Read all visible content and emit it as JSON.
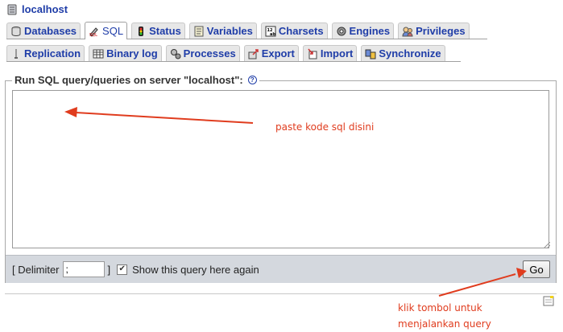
{
  "header": {
    "server_label": "localhost"
  },
  "tabs_row1": [
    {
      "label": "Databases",
      "icon": "database-icon"
    },
    {
      "label": "SQL",
      "icon": "sql-icon",
      "active": true
    },
    {
      "label": "Status",
      "icon": "status-icon"
    },
    {
      "label": "Variables",
      "icon": "variables-icon"
    },
    {
      "label": "Charsets",
      "icon": "charsets-icon"
    },
    {
      "label": "Engines",
      "icon": "engines-icon"
    },
    {
      "label": "Privileges",
      "icon": "privileges-icon"
    }
  ],
  "tabs_row2": [
    {
      "label": "Replication",
      "icon": "replication-icon"
    },
    {
      "label": "Binary log",
      "icon": "binary-log-icon"
    },
    {
      "label": "Processes",
      "icon": "processes-icon"
    },
    {
      "label": "Export",
      "icon": "export-icon"
    },
    {
      "label": "Import",
      "icon": "import-icon"
    },
    {
      "label": "Synchronize",
      "icon": "synchronize-icon"
    }
  ],
  "query_form": {
    "legend": "Run SQL query/queries on server \"localhost\":",
    "help_icon": "help-icon",
    "textarea_value": "",
    "delimiter_label_open": "[ Delimiter",
    "delimiter_value": ";",
    "delimiter_label_close": "]",
    "show_query_checked": true,
    "show_query_label": "Show this query here again",
    "go_label": "Go"
  },
  "annotations": {
    "paste_hint": "paste kode sql disini",
    "click_hint_line1": "klik tombol untuk",
    "click_hint_line2": "menjalankan query",
    "color": "#e03c1e"
  },
  "colors": {
    "link": "#1f3da8",
    "toolbar_bg": "#d4d8de",
    "tab_bg": "#e7e7e7"
  }
}
